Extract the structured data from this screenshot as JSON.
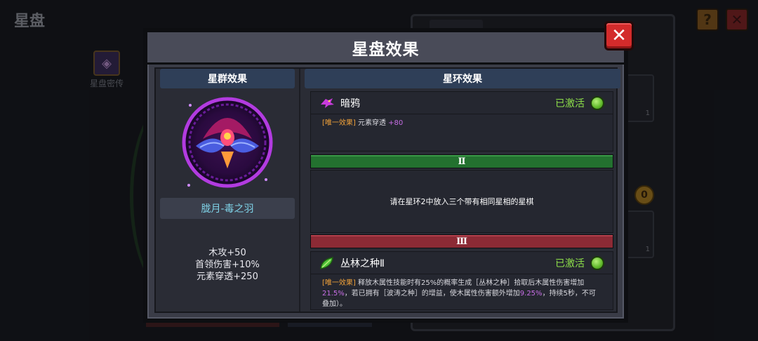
{
  "background": {
    "title": "星盘",
    "help_label": "?",
    "close_label": "✕",
    "secret_label": "星盘密传",
    "slot_count_1": "1",
    "slot_count_2": "1",
    "coin_label": "0"
  },
  "modal": {
    "title": "星盘效果",
    "close_label": "✕"
  },
  "constellation": {
    "header": "星群效果",
    "formation_name": "胧月-毒之羽",
    "stats": [
      "木攻+50",
      "首领伤害+10%",
      "元素穿透+250"
    ]
  },
  "ring_effects": {
    "header": "星环效果",
    "effect1": {
      "name": "暗鸦",
      "icon": "raven-icon",
      "status": "已激活",
      "tag": "[唯一效果]",
      "desc_prefix": " 元素穿透 ",
      "desc_value": "+80"
    },
    "ring2_label": "Ⅱ",
    "ring2_hint": "请在星环2中放入三个带有相同星相的星棋",
    "ring3_label": "Ⅲ",
    "effect2": {
      "name": "丛林之种Ⅱ",
      "icon": "leaf-icon",
      "status": "已激活",
      "tag": "[唯一效果]",
      "desc_part1": " 释放木属性技能时有25%的概率生成［丛林之种］拾取后木属性伤害增加",
      "desc_value1": "21.5%",
      "desc_part2": "，若已拥有［波涛之种］的增益，使木属性伤害额外增加",
      "desc_value2": "9.25%",
      "desc_part3": "，持续5秒，不可叠加）。"
    }
  },
  "colors": {
    "accent_green": "#8ee04a",
    "unique_tag": "#f0a13a",
    "highlight_purple": "#c86ee6",
    "formation_name": "#7fd3e8",
    "ring2_bar": "#23712f",
    "ring3_bar": "#8c2a35"
  }
}
